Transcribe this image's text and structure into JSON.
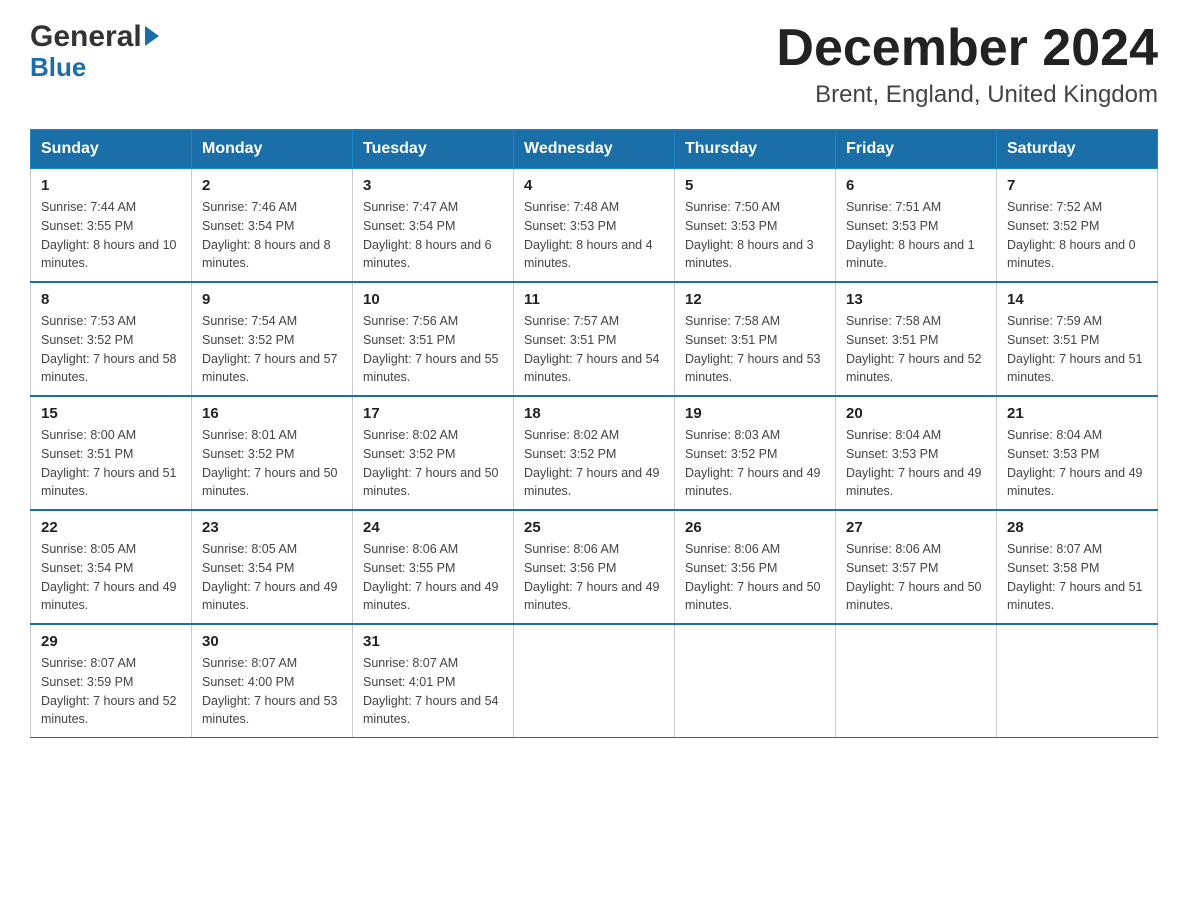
{
  "header": {
    "title": "December 2024",
    "subtitle": "Brent, England, United Kingdom"
  },
  "logo": {
    "general": "General",
    "blue": "Blue"
  },
  "calendar": {
    "days": [
      "Sunday",
      "Monday",
      "Tuesday",
      "Wednesday",
      "Thursday",
      "Friday",
      "Saturday"
    ],
    "weeks": [
      [
        {
          "num": "1",
          "sunrise": "7:44 AM",
          "sunset": "3:55 PM",
          "daylight": "8 hours and 10 minutes."
        },
        {
          "num": "2",
          "sunrise": "7:46 AM",
          "sunset": "3:54 PM",
          "daylight": "8 hours and 8 minutes."
        },
        {
          "num": "3",
          "sunrise": "7:47 AM",
          "sunset": "3:54 PM",
          "daylight": "8 hours and 6 minutes."
        },
        {
          "num": "4",
          "sunrise": "7:48 AM",
          "sunset": "3:53 PM",
          "daylight": "8 hours and 4 minutes."
        },
        {
          "num": "5",
          "sunrise": "7:50 AM",
          "sunset": "3:53 PM",
          "daylight": "8 hours and 3 minutes."
        },
        {
          "num": "6",
          "sunrise": "7:51 AM",
          "sunset": "3:53 PM",
          "daylight": "8 hours and 1 minute."
        },
        {
          "num": "7",
          "sunrise": "7:52 AM",
          "sunset": "3:52 PM",
          "daylight": "8 hours and 0 minutes."
        }
      ],
      [
        {
          "num": "8",
          "sunrise": "7:53 AM",
          "sunset": "3:52 PM",
          "daylight": "7 hours and 58 minutes."
        },
        {
          "num": "9",
          "sunrise": "7:54 AM",
          "sunset": "3:52 PM",
          "daylight": "7 hours and 57 minutes."
        },
        {
          "num": "10",
          "sunrise": "7:56 AM",
          "sunset": "3:51 PM",
          "daylight": "7 hours and 55 minutes."
        },
        {
          "num": "11",
          "sunrise": "7:57 AM",
          "sunset": "3:51 PM",
          "daylight": "7 hours and 54 minutes."
        },
        {
          "num": "12",
          "sunrise": "7:58 AM",
          "sunset": "3:51 PM",
          "daylight": "7 hours and 53 minutes."
        },
        {
          "num": "13",
          "sunrise": "7:58 AM",
          "sunset": "3:51 PM",
          "daylight": "7 hours and 52 minutes."
        },
        {
          "num": "14",
          "sunrise": "7:59 AM",
          "sunset": "3:51 PM",
          "daylight": "7 hours and 51 minutes."
        }
      ],
      [
        {
          "num": "15",
          "sunrise": "8:00 AM",
          "sunset": "3:51 PM",
          "daylight": "7 hours and 51 minutes."
        },
        {
          "num": "16",
          "sunrise": "8:01 AM",
          "sunset": "3:52 PM",
          "daylight": "7 hours and 50 minutes."
        },
        {
          "num": "17",
          "sunrise": "8:02 AM",
          "sunset": "3:52 PM",
          "daylight": "7 hours and 50 minutes."
        },
        {
          "num": "18",
          "sunrise": "8:02 AM",
          "sunset": "3:52 PM",
          "daylight": "7 hours and 49 minutes."
        },
        {
          "num": "19",
          "sunrise": "8:03 AM",
          "sunset": "3:52 PM",
          "daylight": "7 hours and 49 minutes."
        },
        {
          "num": "20",
          "sunrise": "8:04 AM",
          "sunset": "3:53 PM",
          "daylight": "7 hours and 49 minutes."
        },
        {
          "num": "21",
          "sunrise": "8:04 AM",
          "sunset": "3:53 PM",
          "daylight": "7 hours and 49 minutes."
        }
      ],
      [
        {
          "num": "22",
          "sunrise": "8:05 AM",
          "sunset": "3:54 PM",
          "daylight": "7 hours and 49 minutes."
        },
        {
          "num": "23",
          "sunrise": "8:05 AM",
          "sunset": "3:54 PM",
          "daylight": "7 hours and 49 minutes."
        },
        {
          "num": "24",
          "sunrise": "8:06 AM",
          "sunset": "3:55 PM",
          "daylight": "7 hours and 49 minutes."
        },
        {
          "num": "25",
          "sunrise": "8:06 AM",
          "sunset": "3:56 PM",
          "daylight": "7 hours and 49 minutes."
        },
        {
          "num": "26",
          "sunrise": "8:06 AM",
          "sunset": "3:56 PM",
          "daylight": "7 hours and 50 minutes."
        },
        {
          "num": "27",
          "sunrise": "8:06 AM",
          "sunset": "3:57 PM",
          "daylight": "7 hours and 50 minutes."
        },
        {
          "num": "28",
          "sunrise": "8:07 AM",
          "sunset": "3:58 PM",
          "daylight": "7 hours and 51 minutes."
        }
      ],
      [
        {
          "num": "29",
          "sunrise": "8:07 AM",
          "sunset": "3:59 PM",
          "daylight": "7 hours and 52 minutes."
        },
        {
          "num": "30",
          "sunrise": "8:07 AM",
          "sunset": "4:00 PM",
          "daylight": "7 hours and 53 minutes."
        },
        {
          "num": "31",
          "sunrise": "8:07 AM",
          "sunset": "4:01 PM",
          "daylight": "7 hours and 54 minutes."
        },
        null,
        null,
        null,
        null
      ]
    ]
  }
}
